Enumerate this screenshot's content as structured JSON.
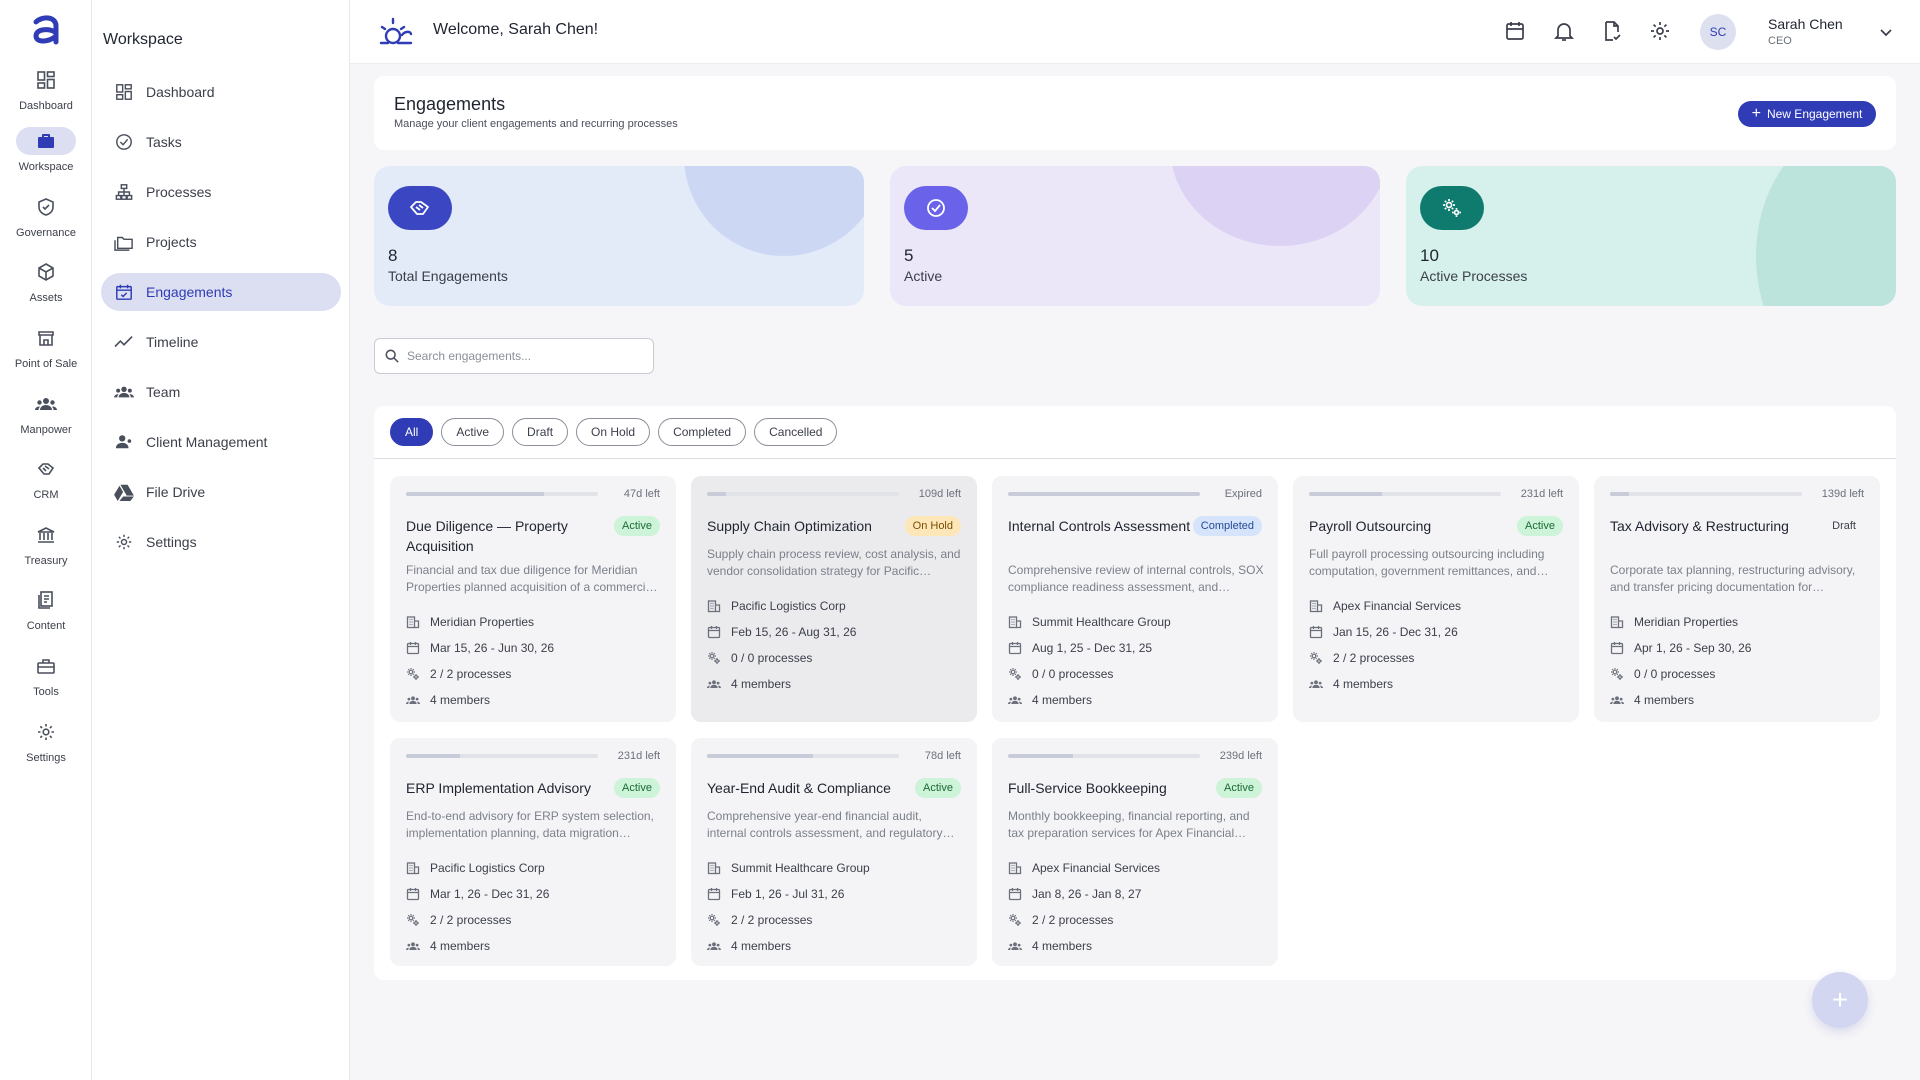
{
  "rail": {
    "items": [
      {
        "label": "Dashboard",
        "icon": "dashboard-icon"
      },
      {
        "label": "Workspace",
        "icon": "briefcase-icon",
        "active": true
      },
      {
        "label": "Governance",
        "icon": "shield-icon"
      },
      {
        "label": "Assets",
        "icon": "cube-icon"
      },
      {
        "label": "Point of Sale",
        "icon": "store-icon"
      },
      {
        "label": "Manpower",
        "icon": "people-icon"
      },
      {
        "label": "CRM",
        "icon": "handshake-icon"
      },
      {
        "label": "Treasury",
        "icon": "bank-icon"
      },
      {
        "label": "Content",
        "icon": "document-icon"
      },
      {
        "label": "Tools",
        "icon": "toolbox-icon"
      },
      {
        "label": "Settings",
        "icon": "gear-icon"
      }
    ]
  },
  "sidebar": {
    "title": "Workspace",
    "items": [
      {
        "label": "Dashboard",
        "icon": "dashboard-icon"
      },
      {
        "label": "Tasks",
        "icon": "check-circle-icon"
      },
      {
        "label": "Processes",
        "icon": "hierarchy-icon"
      },
      {
        "label": "Projects",
        "icon": "folders-icon"
      },
      {
        "label": "Engagements",
        "icon": "calendar-check-icon",
        "active": true
      },
      {
        "label": "Timeline",
        "icon": "trend-line-icon"
      },
      {
        "label": "Team",
        "icon": "people-icon"
      },
      {
        "label": "Client Management",
        "icon": "client-icon"
      },
      {
        "label": "File Drive",
        "icon": "drive-icon"
      },
      {
        "label": "Settings",
        "icon": "gear-icon"
      }
    ]
  },
  "header": {
    "welcome": "Welcome, Sarah Chen!",
    "user_initials": "SC",
    "user_name": "Sarah Chen",
    "user_role": "CEO"
  },
  "page": {
    "title": "Engagements",
    "subtitle": "Manage your client engagements and recurring processes",
    "new_button": "New Engagement"
  },
  "stats": [
    {
      "value": "8",
      "label": "Total Engagements",
      "color": "#3a46c2",
      "bg": "#e3ebf8"
    },
    {
      "value": "5",
      "label": "Active",
      "color": "#6a63ea",
      "bg": "#ebe6f8"
    },
    {
      "value": "10",
      "label": "Active Processes",
      "color": "#0f7b6e",
      "bg": "#d6f1ec"
    }
  ],
  "search": {
    "placeholder": "Search engagements..."
  },
  "filters": [
    "All",
    "Active",
    "Draft",
    "On Hold",
    "Completed",
    "Cancelled"
  ],
  "engagements": [
    {
      "title": "Due Diligence — Property Acquisition",
      "status": "Active",
      "status_type": "active",
      "days": "47d left",
      "progress": 0.72,
      "desc": "Financial and tax due diligence for Meridian Properties planned acquisition of a commerci…",
      "client": "Meridian Properties",
      "dates": "Mar 15, 26 - Jun 30, 26",
      "processes": "2 / 2 processes",
      "members": "4 members"
    },
    {
      "title": "Supply Chain Optimization",
      "status": "On Hold",
      "status_type": "onhold",
      "days": "109d left",
      "progress": 0.1,
      "desc": "Supply chain process review, cost analysis, and vendor consolidation strategy for Pacific…",
      "client": "Pacific Logistics Corp",
      "dates": "Feb 15, 26 - Aug 31, 26",
      "processes": "0 / 0 processes",
      "members": "4 members"
    },
    {
      "title": "Internal Controls Assessment",
      "status": "Completed",
      "status_type": "completed",
      "days": "Expired",
      "progress": 1.0,
      "desc": "Comprehensive review of internal controls, SOX compliance readiness assessment, and…",
      "client": "Summit Healthcare Group",
      "dates": "Aug 1, 25 - Dec 31, 25",
      "processes": "0 / 0 processes",
      "members": "4 members"
    },
    {
      "title": "Payroll Outsourcing",
      "status": "Active",
      "status_type": "active",
      "days": "231d left",
      "progress": 0.38,
      "desc": "Full payroll processing outsourcing including computation, government remittances, and…",
      "client": "Apex Financial Services",
      "dates": "Jan 15, 26 - Dec 31, 26",
      "processes": "2 / 2 processes",
      "members": "4 members"
    },
    {
      "title": "Tax Advisory & Restructuring",
      "status": "Draft",
      "status_type": "draft",
      "days": "139d left",
      "progress": 0.1,
      "desc": "Corporate tax planning, restructuring advisory, and transfer pricing documentation for…",
      "client": "Meridian Properties",
      "dates": "Apr 1, 26 - Sep 30, 26",
      "processes": "0 / 0 processes",
      "members": "4 members"
    },
    {
      "title": "ERP Implementation Advisory",
      "status": "Active",
      "status_type": "active",
      "days": "231d left",
      "progress": 0.28,
      "desc": "End-to-end advisory for ERP system selection, implementation planning, data migration…",
      "client": "Pacific Logistics Corp",
      "dates": "Mar 1, 26 - Dec 31, 26",
      "processes": "2 / 2 processes",
      "members": "4 members"
    },
    {
      "title": "Year-End Audit & Compliance",
      "status": "Active",
      "status_type": "active",
      "days": "78d left",
      "progress": 0.55,
      "desc": "Comprehensive year-end financial audit, internal controls assessment, and regulatory…",
      "client": "Summit Healthcare Group",
      "dates": "Feb 1, 26 - Jul 31, 26",
      "processes": "2 / 2 processes",
      "members": "4 members"
    },
    {
      "title": "Full-Service Bookkeeping",
      "status": "Active",
      "status_type": "active",
      "days": "239d left",
      "progress": 0.34,
      "desc": "Monthly bookkeeping, financial reporting, and tax preparation services for Apex Financial…",
      "client": "Apex Financial Services",
      "dates": "Jan 8, 26 - Jan 8, 27",
      "processes": "2 / 2 processes",
      "members": "4 members"
    }
  ]
}
